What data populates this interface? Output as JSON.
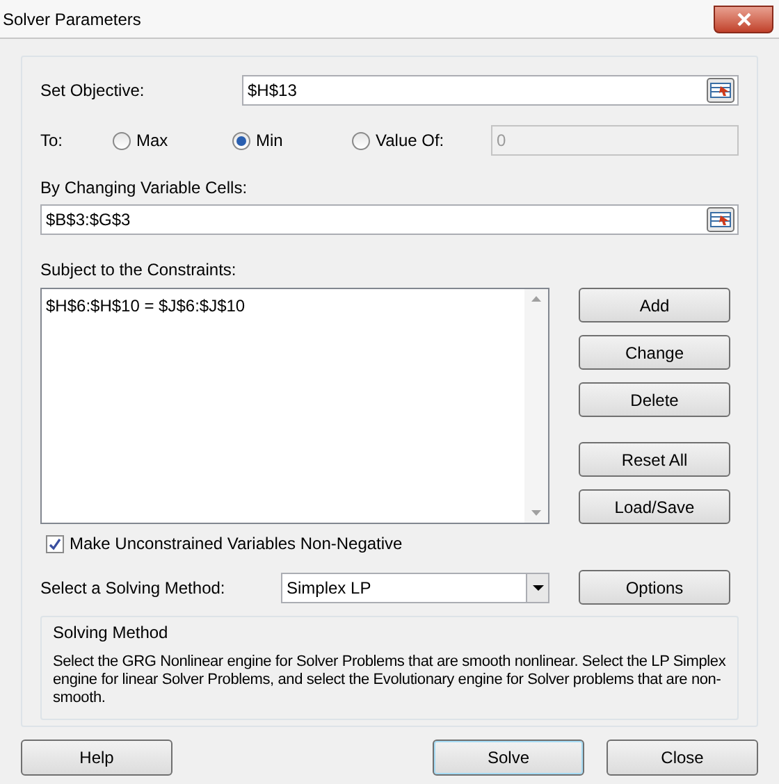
{
  "window": {
    "title": "Solver Parameters"
  },
  "objective": {
    "label": "Set Objective:",
    "value": "$H$13"
  },
  "to": {
    "label": "To:",
    "options": [
      {
        "label": "Max",
        "selected": false
      },
      {
        "label": "Min",
        "selected": true
      },
      {
        "label": "Value Of:",
        "selected": false
      }
    ],
    "value_field": {
      "value": "0",
      "disabled": true
    }
  },
  "variable_cells": {
    "label": "By Changing Variable Cells:",
    "value": "$B$3:$G$3"
  },
  "constraints": {
    "label": "Subject to the Constraints:",
    "items": [
      "$H$6:$H$10 = $J$6:$J$10"
    ]
  },
  "constraint_buttons": [
    "Add",
    "Change",
    "Delete",
    "Reset All",
    "Load/Save"
  ],
  "non_negative": {
    "label": "Make Unconstrained Variables Non-Negative",
    "checked": true
  },
  "method": {
    "label": "Select a Solving Method:",
    "value": "Simplex LP",
    "options_button": "Options"
  },
  "method_info": {
    "title": "Solving Method",
    "text": "Select the GRG Nonlinear engine for Solver Problems that are smooth nonlinear. Select the LP Simplex engine for linear Solver Problems, and select the Evolutionary engine for Solver problems that are non-smooth."
  },
  "footer_buttons": [
    {
      "label": "Help",
      "default": false
    },
    {
      "label": "Solve",
      "default": true
    },
    {
      "label": "Close",
      "default": false
    }
  ]
}
